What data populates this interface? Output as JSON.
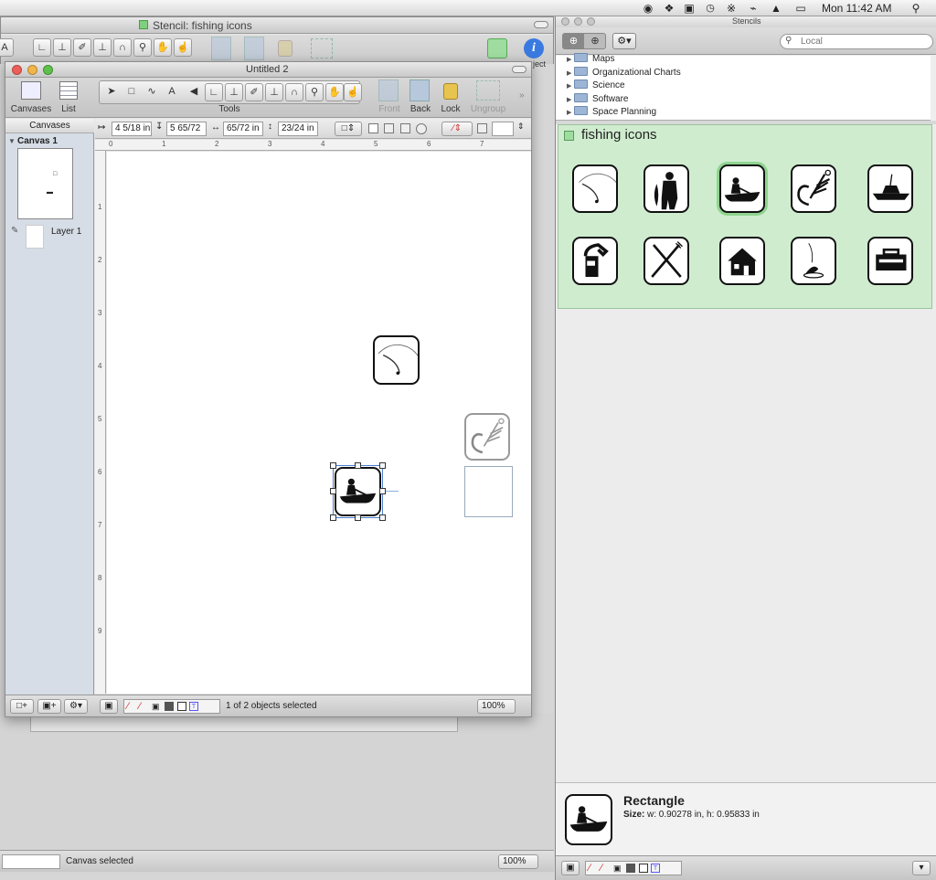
{
  "menubar": {
    "clock": "Mon 11:42 AM",
    "icons": [
      "webcam-icon",
      "dropbox-icon",
      "display-icon",
      "screen-icon",
      "time-machine-icon",
      "bluetooth-icon",
      "wifi-icon",
      "volume-icon",
      "battery-icon",
      "spotlight-icon"
    ]
  },
  "stencil_window": {
    "title": "Stencil: fishing icons",
    "tab_fragment": "ject"
  },
  "doc_window": {
    "title": "Untitled 2",
    "toolbar": {
      "canvases": "Canvases",
      "list": "List",
      "tools": "Tools",
      "front": "Front",
      "back": "Back",
      "lock": "Lock",
      "ungroup": "Ungroup"
    },
    "inspector_bar": {
      "x": "4 5/18 in",
      "y": "5 65/72",
      "w": "65/72 in",
      "h": "23/24 in"
    },
    "sidebar": {
      "header": "Canvases",
      "canvas_name": "Canvas 1",
      "layer_name": "Layer 1"
    },
    "ruler_numbers": [
      "0",
      "1",
      "2",
      "3",
      "4",
      "5",
      "6",
      "7"
    ],
    "ruler_v_numbers": [
      "1",
      "2",
      "3",
      "4",
      "5",
      "6",
      "7",
      "8",
      "9"
    ],
    "status": "1 of 2 objects selected",
    "zoom": "100%"
  },
  "behind_window": {
    "status": "Canvas selected",
    "zoom": "100%"
  },
  "stencils_panel": {
    "title": "Stencils",
    "search_placeholder": "Local",
    "folders": [
      "Maps",
      "Organizational Charts",
      "Science",
      "Software",
      "Space Planning"
    ],
    "stencil_title": "fishing icons",
    "icons": [
      "fishing-rod",
      "fisherman-with-fish",
      "man-in-boat",
      "fishing-fly",
      "motorboat",
      "fuel-pump",
      "fork-and-knife",
      "cabin",
      "ice-fishing",
      "tackle-box"
    ],
    "info": {
      "name": "Rectangle",
      "size_label": "Size:",
      "size_value": "w: 0.90278 in, h: 0.95833 in"
    }
  },
  "colors": {
    "stencil_bg": "#cfeccf",
    "selection": "#4a7fd0"
  }
}
